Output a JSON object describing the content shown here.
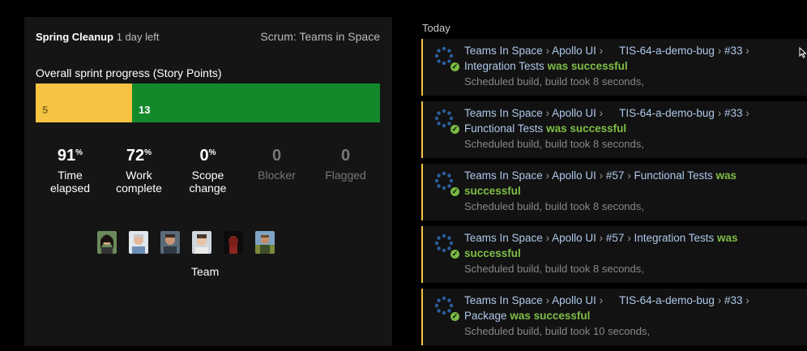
{
  "sprint": {
    "name": "Spring Cleanup",
    "days_left": "1 day left",
    "team": "Scrum: Teams in Space",
    "progress_label": "Overall sprint progress (Story Points)",
    "done_points": "5",
    "todo_points": "13",
    "done_fraction": 0.28,
    "stats": [
      {
        "num": "91",
        "unit": "%",
        "l1": "Time",
        "l2": "elapsed"
      },
      {
        "num": "72",
        "unit": "%",
        "l1": "Work",
        "l2": "complete"
      },
      {
        "num": "0",
        "unit": "%",
        "l1": "Scope",
        "l2": "change"
      },
      {
        "num": "0",
        "unit": "",
        "l1": "Blocker",
        "l2": ""
      },
      {
        "num": "0",
        "unit": "",
        "l1": "Flagged",
        "l2": ""
      }
    ],
    "team_label": "Team",
    "colors": {
      "done": "#f6c342",
      "todo": "#14892c",
      "success": "#7fbe47",
      "link": "#aec8ea"
    }
  },
  "activity": {
    "header": "Today",
    "items": [
      {
        "p1": "Teams In Space",
        "p2": "Apollo UI",
        "p3": "TIS-64-a-demo-bug",
        "p4": "#33",
        "target": "Integration Tests",
        "status_a": "was successful",
        "status_b": "",
        "detail": "Scheduled build, build took 8 seconds,"
      },
      {
        "p1": "Teams In Space",
        "p2": "Apollo UI",
        "p3": "TIS-64-a-demo-bug",
        "p4": "#33",
        "target": "Functional Tests",
        "status_a": "was successful",
        "status_b": "",
        "detail": "Scheduled build, build took 8 seconds,"
      },
      {
        "p1": "Teams In Space",
        "p2": "Apollo UI",
        "p3": "#57",
        "p4": "Functional Tests",
        "target": "",
        "status_a": "was",
        "status_b": "successful",
        "detail": "Scheduled build, build took 8 seconds,"
      },
      {
        "p1": "Teams In Space",
        "p2": "Apollo UI",
        "p3": "#57",
        "p4": "Integration Tests",
        "target": "",
        "status_a": "was",
        "status_b": "successful",
        "detail": "Scheduled build, build took 8 seconds,"
      },
      {
        "p1": "Teams In Space",
        "p2": "Apollo UI",
        "p3": "TIS-64-a-demo-bug",
        "p4": "#33",
        "target": "Package",
        "status_a": "was successful",
        "status_b": "",
        "detail": "Scheduled build, build took 10 seconds,"
      }
    ]
  },
  "icons": {
    "spinner": "build-spinner-icon",
    "check": "check-circle-icon",
    "cursor": "mouse-cursor-icon"
  }
}
